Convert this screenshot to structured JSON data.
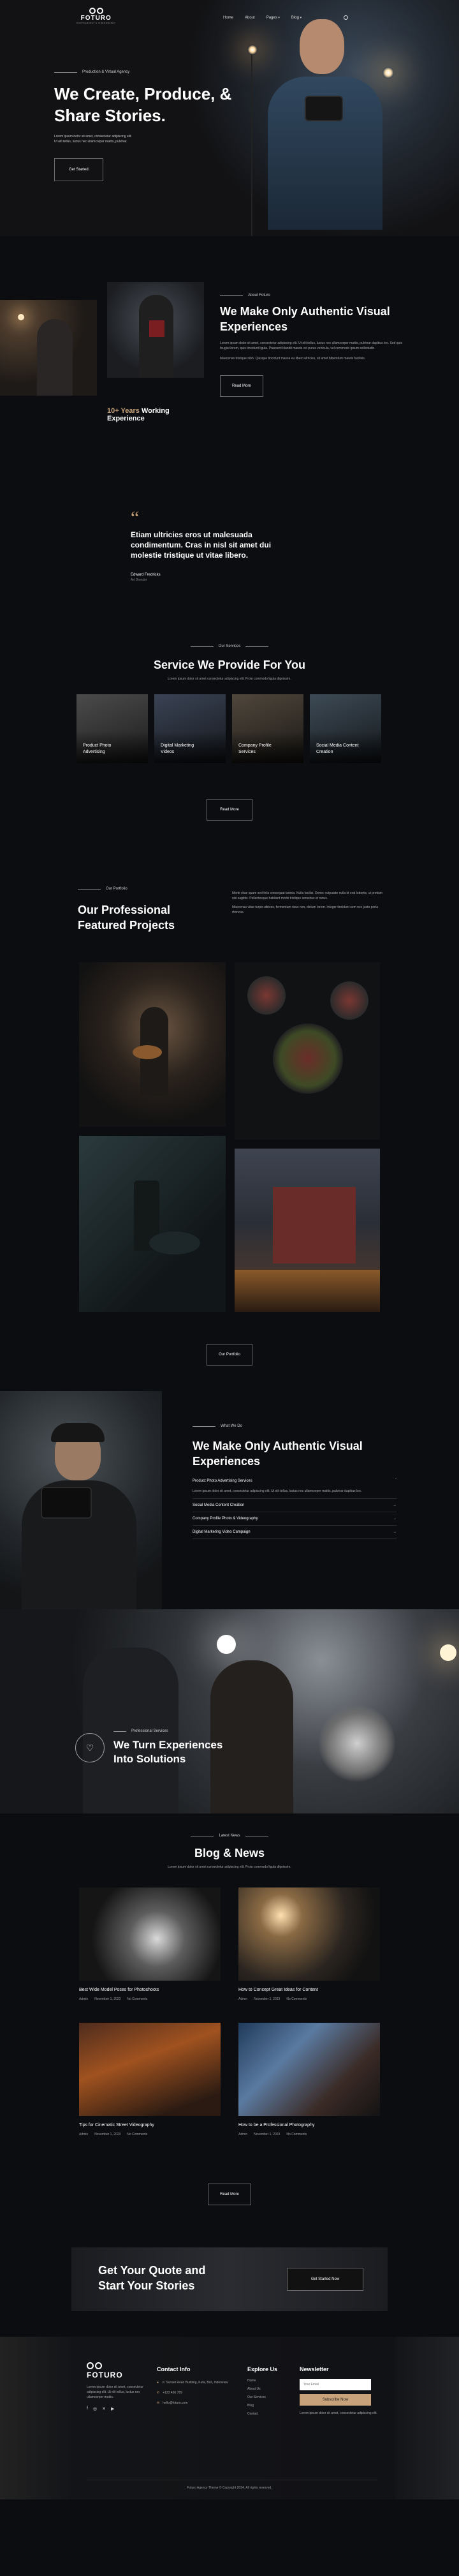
{
  "brand": {
    "name": "FOTURO",
    "tagline": "PHOTOGRAPHY & VIDEOGRAPHY"
  },
  "nav": {
    "items": [
      "Home",
      "About",
      "Pages",
      "Blog"
    ],
    "search_icon": "search-icon",
    "dropdown_icon": "chevron-down-icon"
  },
  "hero": {
    "eyebrow": "Production & Virtual Agency",
    "title_line1": "We Create, Produce, &",
    "title_line2": "Share Stories.",
    "text_line1": "Lorem ipsum dolor sit amet, consectetur adipiscing elit.",
    "text_line2": "Ut elit tellus, luctus nec ullamcorper mattis, pulvinar.",
    "button": "Get Started"
  },
  "about": {
    "eyebrow": "About Foturo",
    "title_line1": "We Make Only Authentic Visual",
    "title_line2": "Experiences",
    "p1": "Lorem ipsum dolor sit amet, consectetur adipiscing elit. Ut elit tellus, luctus nec ullamcorper mattis, pulvinar dapibus leo. Sed quis feugiat lorem, quis tincidunt ligula. Praesent blandit mauris vel purus vehicula, vel commodo ipsum sollicitudin.",
    "p2": "Maecenas tristique nibh. Quisque tincidunt massa eu libero ultricies, sit amet bibendum mauris facilisis.",
    "years_number": "10+",
    "years_label": "Years",
    "years_text_line1": "Working",
    "years_text_line2": "Experience",
    "button": "Read More"
  },
  "quote": {
    "text_line1": "Etiam ultricies eros ut malesuada",
    "text_line2": "condimentum. Cras in nisl sit amet dui",
    "text_line3": "molestie tristique ut vitae libero.",
    "author": "Edward Fredricks",
    "role": "Art Director"
  },
  "services": {
    "eyebrow": "Our Services",
    "title": "Service We Provide For You",
    "subtitle": "Lorem ipsum dolor sit amet consectetur adipiscing elit. Proin commodo ligula dignissim.",
    "items": [
      {
        "line1": "Product Photo",
        "line2": "Advertising"
      },
      {
        "line1": "Digital Marketing",
        "line2": "Videos"
      },
      {
        "line1": "Company Profile",
        "line2": "Services"
      },
      {
        "line1": "Social Media Content",
        "line2": "Creation"
      }
    ],
    "button": "Read More"
  },
  "portfolio": {
    "eyebrow": "Our Portfolio",
    "title_line1": "Our Professional",
    "title_line2": "Featured Projects",
    "p1": "Morbi vitae quam sed felis consequat lacinia. Nulla facilisi. Donec vulputate nulla id erat lobortis, ut pretium nisi sagittis. Pellentesque habitant morbi tristique senectus et netus.",
    "p2": "Maecenas vitae turpis ultrices, fermentum risus non, dictum lorem. Integer tincidunt sem nec justo porta rhoncus.",
    "button": "Our Portfolio"
  },
  "whatwedo": {
    "eyebrow": "What We Do",
    "title_line1": "We Make Only Authentic Visual",
    "title_line2": "Experiences",
    "items": [
      "Product Photo Advertising Services",
      "Social Media Content Creation",
      "Company Profile Photo & Videography",
      "Digital Marketing Video Campaign"
    ],
    "desc": "Lorem ipsum dolor sit amet, consectetur adipiscing elit. Ut elit tellus, luctus nec ullamcorper mattis, pulvinar dapibus leo.",
    "arrow_icon": "arrow-right-icon"
  },
  "banner": {
    "eyebrow": "Professional Services",
    "title_line1": "We Turn Experiences",
    "title_line2": "Into Solutions"
  },
  "blog": {
    "eyebrow": "Latest News",
    "title": "Blog & News",
    "subtitle": "Lorem ipsum dolor sit amet consectetur adipiscing elit. Proin commodo ligula dignissim.",
    "posts": [
      {
        "title": "Best Wide Model Poses for Photoshoots",
        "author": "Admin",
        "date": "November 1, 2023",
        "comments": "No Comments"
      },
      {
        "title": "How to Concept Great Ideas for Content",
        "author": "Admin",
        "date": "November 1, 2023",
        "comments": "No Comments"
      },
      {
        "title": "Tips for Cinematic Street Videography",
        "author": "Admin",
        "date": "November 1, 2023",
        "comments": "No Comments"
      },
      {
        "title": "How to be a Professional Photography",
        "author": "Admin",
        "date": "November 1, 2023",
        "comments": "No Comments"
      }
    ],
    "button": "Read More"
  },
  "cta": {
    "title_line1": "Get Your Quote and",
    "title_line2": "Start Your Stories",
    "button": "Get Started Now"
  },
  "footer": {
    "about_text": "Lorem ipsum dolor sit amet, consectetur adipiscing elit. Ut elit tellus, luctus nec ullamcorper mattis.",
    "contact_title": "Contact Info",
    "address": "Jl. Sunset Road Building, Kuta, Bali, Indonesia",
    "phone": "+123 456 789",
    "email": "hello@foturo.com",
    "explore_title": "Explore Us",
    "explore_links": [
      "Home",
      "About Us",
      "Our Services",
      "Blog",
      "Contact"
    ],
    "newsletter_title": "Newsletter",
    "newsletter_placeholder": "Your Email",
    "newsletter_button": "Subscribe Now",
    "newsletter_note": "Lorem ipsum dolor sit amet, consectetur adipiscing elit.",
    "copyright": "Foturo Agency Theme © Copyright 2024. All rights reserved."
  },
  "colors": {
    "bg": "#0c0d10",
    "accent": "#c8a27a"
  }
}
